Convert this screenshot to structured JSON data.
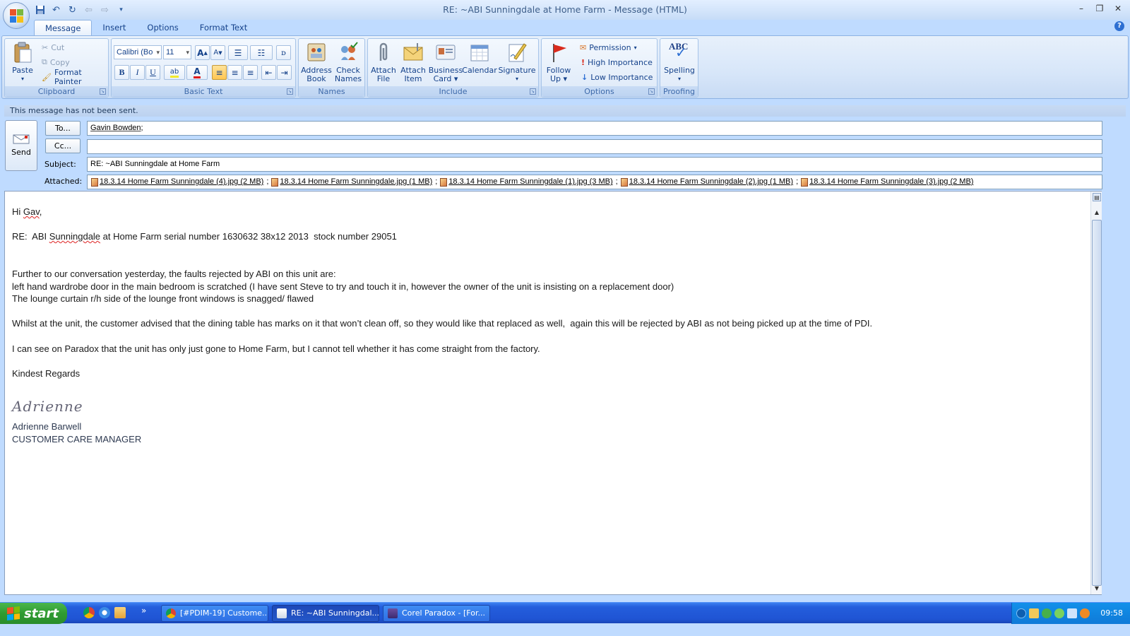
{
  "window": {
    "title": "RE: ~ABI Sunningdale at Home Farm - Message (HTML)"
  },
  "ribbon": {
    "tabs": [
      "Message",
      "Insert",
      "Options",
      "Format Text"
    ],
    "clipboard": {
      "label": "Clipboard",
      "paste": "Paste",
      "cut": "Cut",
      "copy": "Copy",
      "format_painter": "Format Painter"
    },
    "basic_text": {
      "label": "Basic Text",
      "font": "Calibri (Bo",
      "size": "11",
      "bold": "B",
      "italic": "I",
      "underline": "U"
    },
    "names": {
      "label": "Names",
      "address_book_1": "Address",
      "address_book_2": "Book",
      "check_names_1": "Check",
      "check_names_2": "Names"
    },
    "include": {
      "label": "Include",
      "attach_file_1": "Attach",
      "attach_file_2": "File",
      "attach_item_1": "Attach",
      "attach_item_2": "Item",
      "business_card_1": "Business",
      "business_card_2": "Card",
      "calendar": "Calendar",
      "signature": "Signature"
    },
    "options": {
      "label": "Options",
      "follow_up_1": "Follow",
      "follow_up_2": "Up",
      "permission": "Permission",
      "high_importance": "High Importance",
      "low_importance": "Low Importance"
    },
    "proofing": {
      "label": "Proofing",
      "spelling": "Spelling",
      "abc": "ABC"
    }
  },
  "infobar": "This message has not been sent.",
  "header": {
    "send": "Send",
    "to_button": "To...",
    "cc_button": "Cc...",
    "to_value": "Gavin Bowden",
    "to_separator": ";",
    "cc_value": "",
    "subject_label": "Subject:",
    "subject_value": "RE: ~ABI Sunningdale at Home Farm",
    "attached_label": "Attached:",
    "attachments": [
      "18.3.14 Home Farm Sunningdale (4).jpg (2 MB)",
      "18.3.14 Home Farm Sunningdale.jpg (1 MB)",
      "18.3.14 Home Farm Sunningdale (1).jpg (3 MB)",
      "18.3.14 Home Farm Sunningdale (2).jpg (1 MB)",
      "18.3.14 Home Farm Sunningdale (3).jpg (2 MB)"
    ]
  },
  "body": {
    "greeting_prefix": "Hi ",
    "greeting_name": "Gav",
    "greeting_suffix": ",",
    "re_prefix": "RE:  ABI ",
    "re_word": "Sunningdale",
    "re_suffix": " at Home Farm serial number 1630632 38x12 2013  stock number 29051",
    "p1": "Further to our conversation yesterday, the faults rejected by ABI on this unit are:",
    "p2": "left hand wardrobe door in the main bedroom is scratched (I have sent Steve to try and touch it in, however the owner of the unit is insisting on a replacement door)",
    "p3": "The lounge curtain r/h side of the lounge front windows is snagged/ flawed",
    "p4": "Whilst at the unit, the customer advised that the dining table has marks on it that won’t clean off, so they would like that replaced as well,  again this will be rejected by ABI as not being picked up at the time of PDI.",
    "p5": "I can see on Paradox that the unit has only just gone to Home Farm, but I cannot tell whether it has come straight from the factory.",
    "closing": "Kindest Regards",
    "signature_script": "Adrienne",
    "signature_name": "Adrienne Barwell",
    "signature_title": "CUSTOMER CARE MANAGER"
  },
  "taskbar": {
    "start": "start",
    "more": "»",
    "tasks": [
      "[#PDIM-19] Custome...",
      "RE: ~ABI Sunningdal...",
      "Corel Paradox - [For..."
    ],
    "clock": "09:58"
  }
}
